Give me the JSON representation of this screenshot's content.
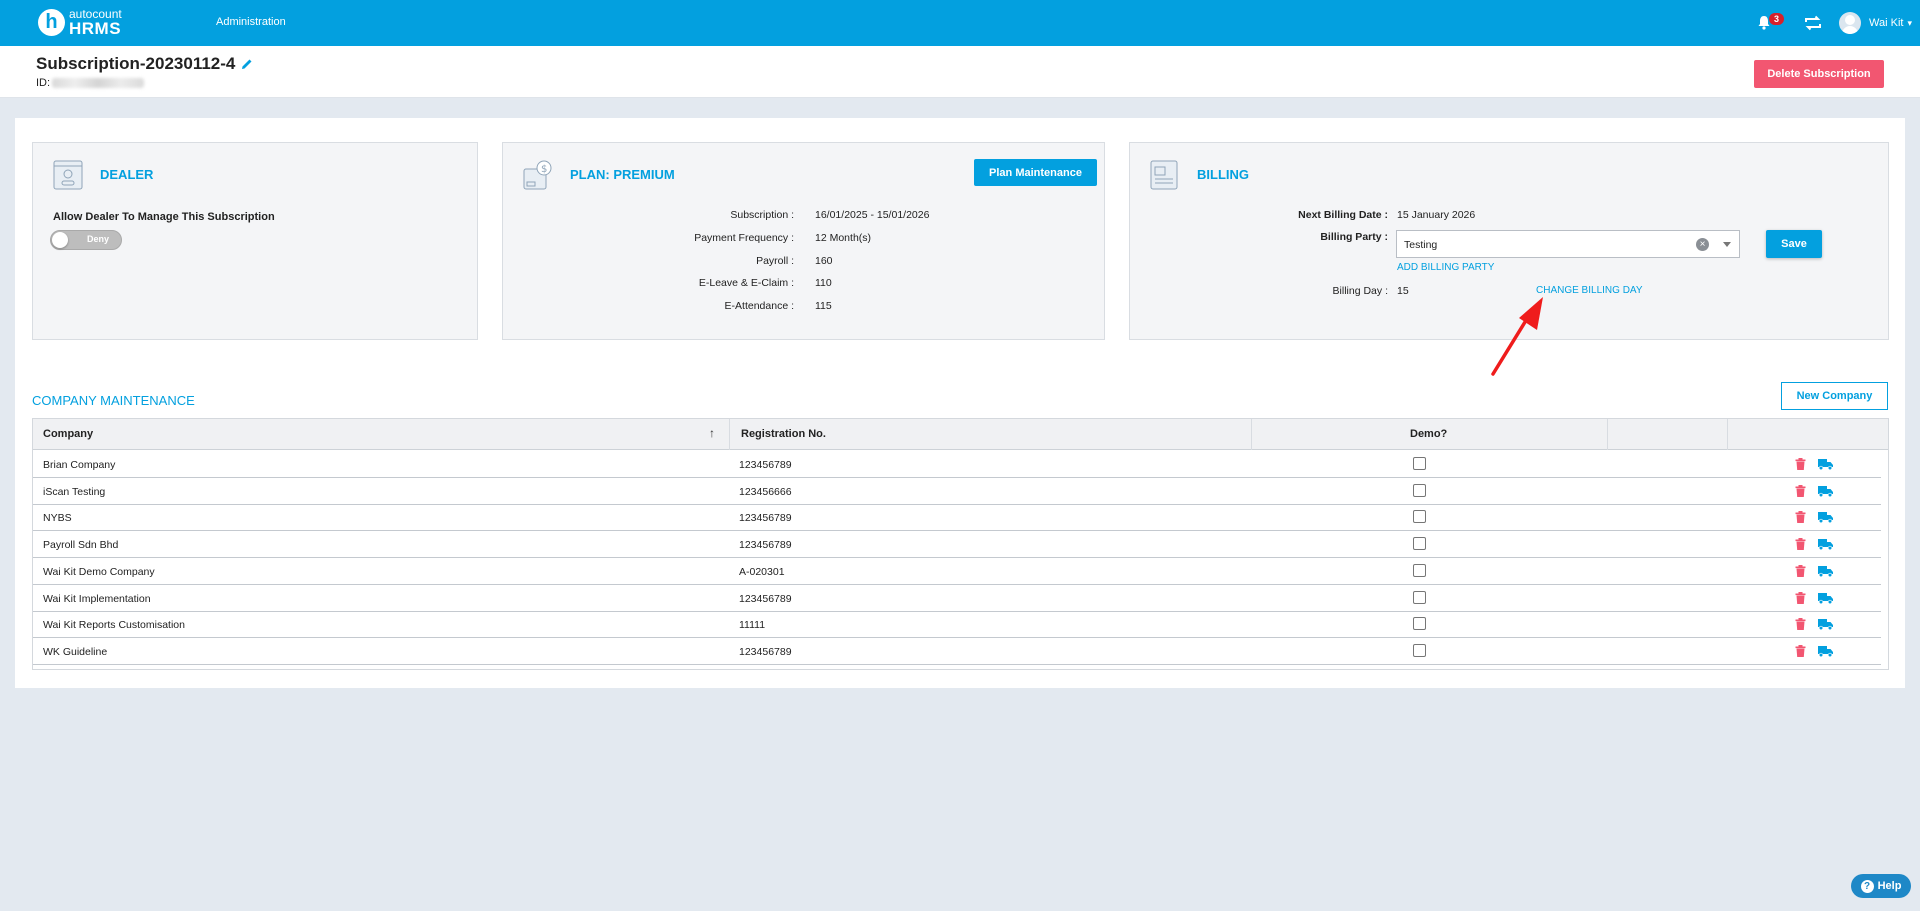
{
  "topbar": {
    "logo_top": "autocount",
    "logo_bottom": "HRMS",
    "logo_letter": "h",
    "nav_admin": "Administration",
    "notification_count": "3",
    "user_name": "Wai Kit",
    "color": "#03a0df"
  },
  "header": {
    "title": "Subscription-20230112-4",
    "id_label": "ID:",
    "delete_button": "Delete Subscription"
  },
  "dealer": {
    "title": "DEALER",
    "allow_label": "Allow Dealer To Manage This Subscription",
    "toggle_text": "Deny"
  },
  "plan": {
    "title": "PLAN: PREMIUM",
    "button": "Plan Maintenance",
    "fields": [
      {
        "label": "Subscription :",
        "value": "16/01/2025 - 15/01/2026"
      },
      {
        "label": "Payment Frequency :",
        "value": "12 Month(s)"
      },
      {
        "label": "Payroll :",
        "value": "160"
      },
      {
        "label": "E-Leave & E-Claim :",
        "value": "110"
      },
      {
        "label": "E-Attendance :",
        "value": "115"
      }
    ]
  },
  "billing": {
    "title": "BILLING",
    "next_billing_label": "Next Billing Date :",
    "next_billing_value": "15 January 2026",
    "party_label": "Billing Party :",
    "party_value": "Testing",
    "add_party_link": "ADD BILLING PARTY",
    "save_button": "Save",
    "day_label": "Billing Day :",
    "day_value": "15",
    "change_day_link": "CHANGE BILLING DAY"
  },
  "company": {
    "section_title": "COMPANY MAINTENANCE",
    "new_button": "New Company",
    "headers": {
      "company": "Company",
      "registration": "Registration No.",
      "demo": "Demo?"
    },
    "rows": [
      {
        "name": "Brian Company",
        "reg": "123456789",
        "demo": false
      },
      {
        "name": "iScan Testing",
        "reg": "123456666",
        "demo": false
      },
      {
        "name": "NYBS",
        "reg": "123456789",
        "demo": false
      },
      {
        "name": "Payroll Sdn Bhd",
        "reg": "123456789",
        "demo": false
      },
      {
        "name": "Wai Kit Demo Company",
        "reg": "A-020301",
        "demo": false
      },
      {
        "name": "Wai Kit Implementation",
        "reg": "123456789",
        "demo": false
      },
      {
        "name": "Wai Kit Reports Customisation",
        "reg": "11111",
        "demo": false
      },
      {
        "name": "WK Guideline",
        "reg": "123456789",
        "demo": false
      }
    ]
  },
  "help": {
    "label": "Help"
  },
  "colors": {
    "primary": "#03a0df",
    "danger": "#f25671",
    "background": "#e3e9f0"
  }
}
